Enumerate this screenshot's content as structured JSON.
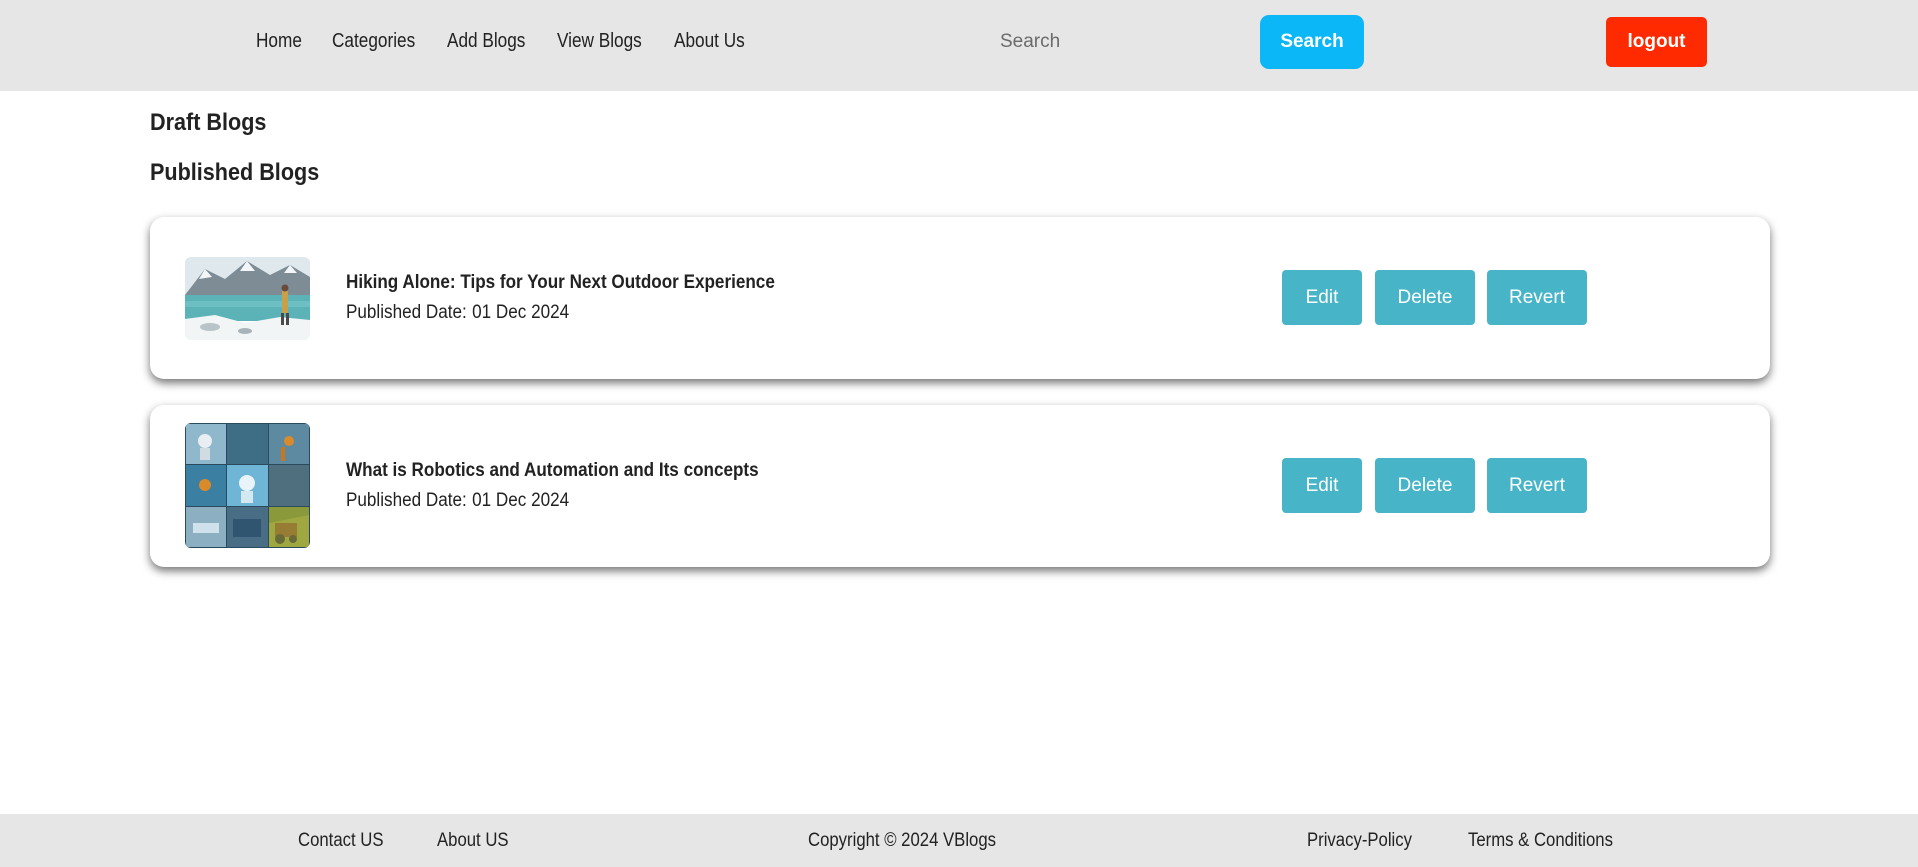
{
  "nav": {
    "links": [
      "Home",
      "Categories",
      "Add Blogs",
      "View Blogs",
      "About Us"
    ],
    "search_placeholder": "Search",
    "search_button": "Search",
    "logout_button": "logout"
  },
  "sections": {
    "draft_title": "Draft Blogs",
    "published_title": "Published Blogs"
  },
  "published_blogs": [
    {
      "title": "Hiking Alone: Tips for Your Next Outdoor Experience",
      "date_label": "Published Date:",
      "date": "01 Dec 2024",
      "image": "hiking-lake-thumbnail",
      "actions": [
        "Edit",
        "Delete",
        "Revert"
      ]
    },
    {
      "title": "What is Robotics and Automation and Its concepts",
      "date_label": "Published Date:",
      "date": "01 Dec 2024",
      "image": "robotics-collage-thumbnail",
      "actions": [
        "Edit",
        "Delete",
        "Revert"
      ]
    }
  ],
  "footer": {
    "contact": "Contact US",
    "about": "About US",
    "copyright": "Copyright © 2024 VBlogs",
    "privacy": "Privacy-Policy",
    "terms": "Terms & Conditions"
  },
  "colors": {
    "navbar_bg": "#e6e6e6",
    "search_button": "#0bb7f7",
    "logout_button": "#ff2a00",
    "action_button": "#48b4c8"
  }
}
